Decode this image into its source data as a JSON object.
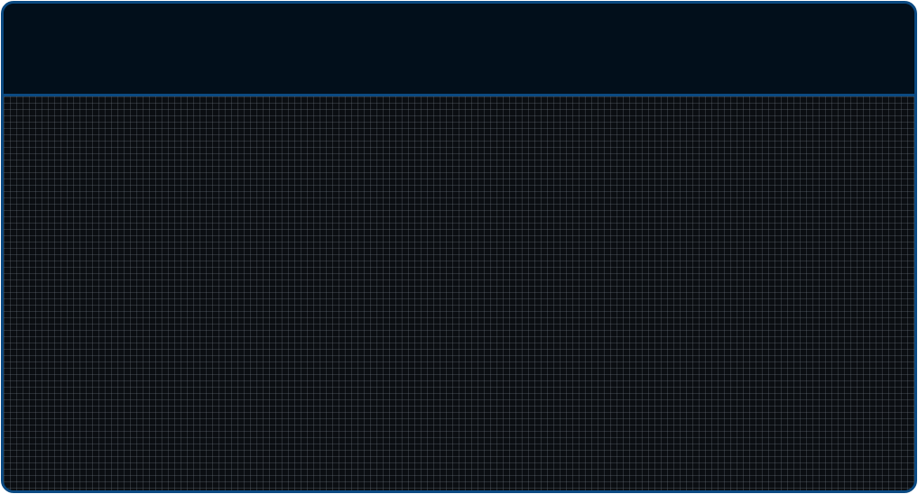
{
  "window": {
    "title": ""
  },
  "colors": {
    "border": "#0b4a82",
    "header_background": "#020f1b",
    "canvas_background": "#0b0e12",
    "grid_line": "#4a5058"
  }
}
